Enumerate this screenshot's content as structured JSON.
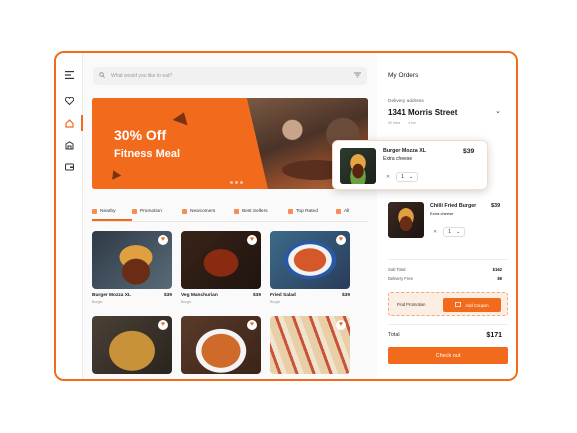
{
  "search": {
    "placeholder": "What would you like to eat?"
  },
  "banner": {
    "headline": "30% Off",
    "subline": "Fitness Meal"
  },
  "tabs": [
    {
      "label": "Nearby",
      "icon": "location-icon"
    },
    {
      "label": "Promotion",
      "icon": "percent-icon"
    },
    {
      "label": "Newcomers",
      "icon": "store-icon"
    },
    {
      "label": "Best Sellers",
      "icon": "star-icon"
    },
    {
      "label": "Top Rated",
      "icon": "thumb-icon"
    },
    {
      "label": "All",
      "icon": "grid-icon"
    }
  ],
  "products": [
    {
      "name": "Burger Mozza XL",
      "price": "$39",
      "sub": "Burger"
    },
    {
      "name": "Veg Manchurian",
      "price": "$39",
      "sub": "Burger"
    },
    {
      "name": "Fried Salad",
      "price": "$39",
      "sub": "Burger"
    }
  ],
  "orders": {
    "title": "My Orders",
    "address_label": "Delivery address",
    "address": "1341 Morris Street",
    "meta": [
      "30 mins",
      "4 km"
    ],
    "items": [
      {
        "name": "Burger Mozza XL",
        "sub": "Extra cheese",
        "price": "$39",
        "qty": "1"
      },
      {
        "name": "Chilli Fried Burger",
        "sub": "Extra cheese",
        "price": "$39",
        "qty": "1"
      }
    ],
    "subtotal_label": "Sub Total",
    "subtotal": "$162",
    "delivery_label": "Delivery Free",
    "delivery": "$9",
    "promo_label": "Find Promotion",
    "coupon_label": "Add Coupon",
    "total_label": "Total",
    "total": "$171",
    "checkout_label": "Check out"
  },
  "colors": {
    "accent": "#f26a1b"
  }
}
